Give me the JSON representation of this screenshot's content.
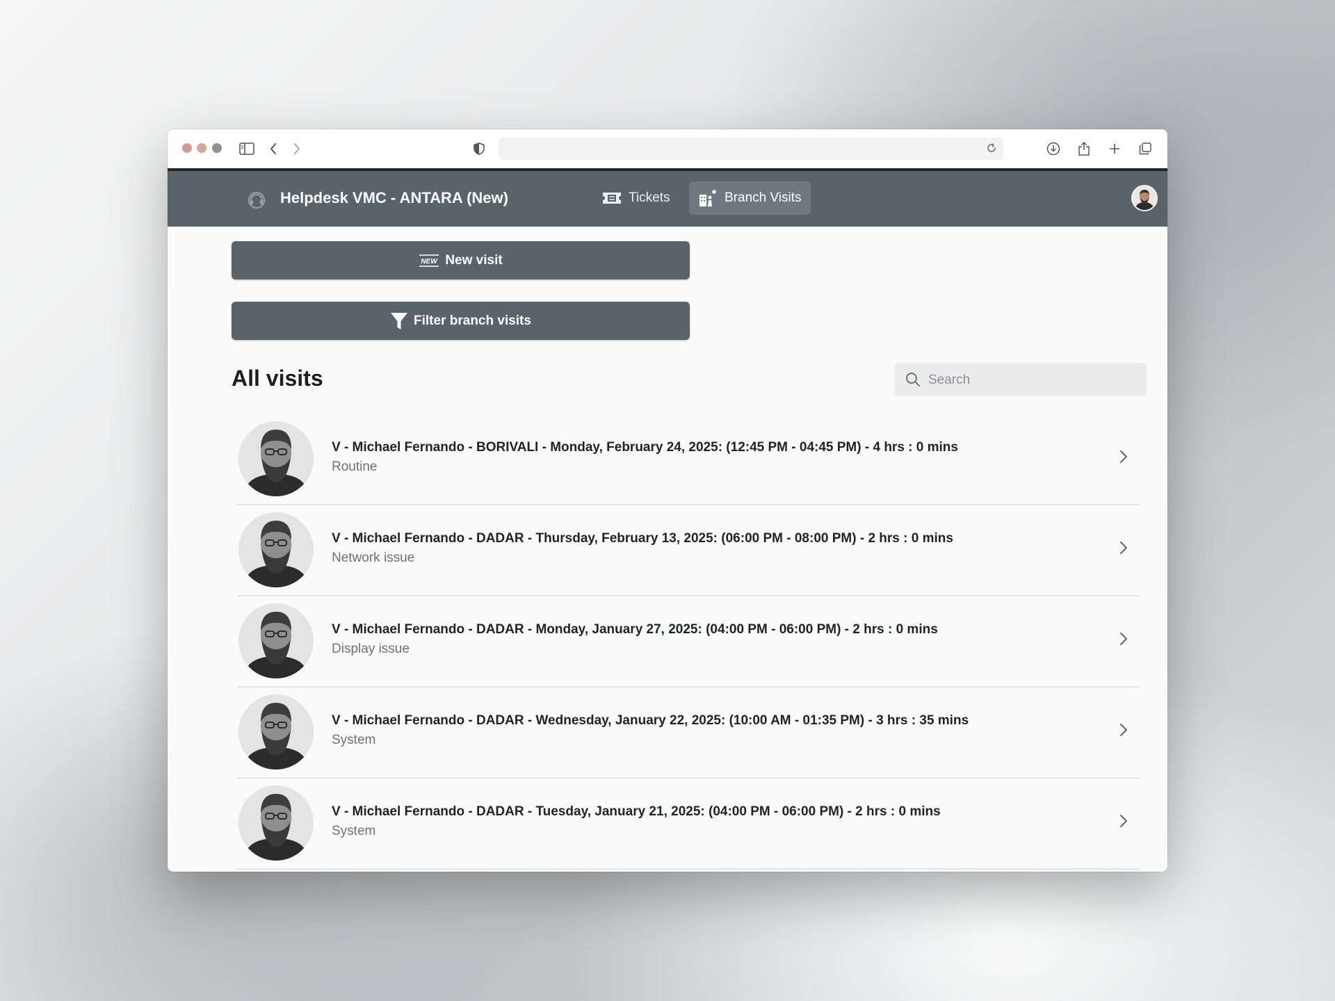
{
  "app": {
    "title": "Helpdesk VMC - ANTARA (New)"
  },
  "nav": {
    "tickets_label": "Tickets",
    "visits_label": "Branch Visits"
  },
  "actions": {
    "new_visit_label": "New visit",
    "new_badge": "NEW",
    "filter_label": "Filter branch visits"
  },
  "list": {
    "heading": "All visits",
    "search_placeholder": "Search",
    "visits": [
      {
        "title": "V - Michael Fernando - BORIVALI - Monday, February 24, 2025: (12:45 PM - 04:45 PM) - 4 hrs : 0 mins",
        "category": "Routine"
      },
      {
        "title": "V - Michael Fernando - DADAR - Thursday, February 13, 2025: (06:00 PM - 08:00 PM) - 2 hrs : 0 mins",
        "category": "Network issue"
      },
      {
        "title": "V - Michael Fernando - DADAR - Monday, January 27, 2025: (04:00 PM - 06:00 PM) - 2 hrs : 0 mins",
        "category": "Display issue"
      },
      {
        "title": "V - Michael Fernando - DADAR - Wednesday, January 22, 2025: (10:00 AM - 01:35 PM) - 3 hrs : 35 mins",
        "category": "System"
      },
      {
        "title": "V - Michael Fernando - DADAR - Tuesday, January 21, 2025: (04:00 PM - 06:00 PM) - 2 hrs : 0 mins",
        "category": "System"
      }
    ]
  },
  "colors": {
    "header_bg": "#59636b",
    "nav_active_bg": "#6e7880",
    "button_bg": "#59636b",
    "page_bg": "#fafafa"
  }
}
